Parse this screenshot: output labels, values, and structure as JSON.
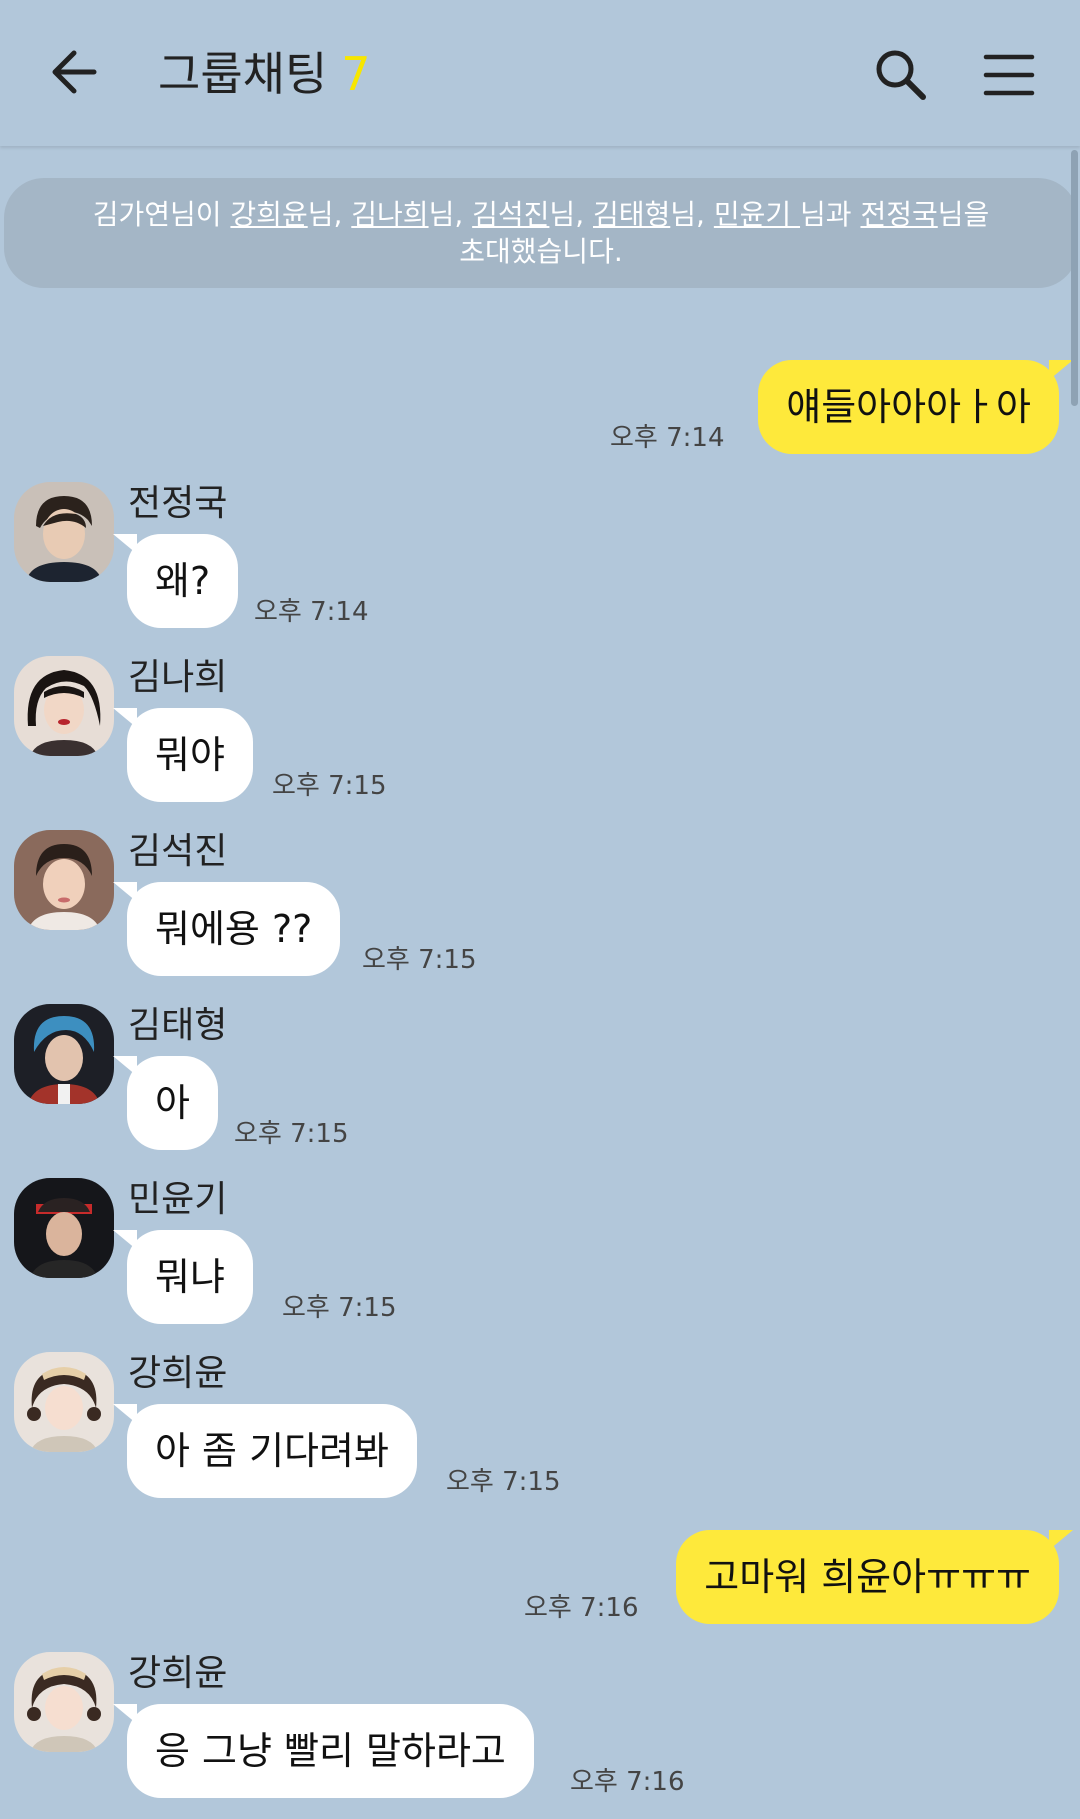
{
  "header": {
    "title": "그룹채팅",
    "member_count": "7"
  },
  "notice": {
    "inviter": "김가연",
    "invitees": [
      "강희윤",
      "김나희",
      "김석진",
      "김태형",
      "민윤기 ",
      "전정국"
    ],
    "suffix_nim": "님",
    "suffix_nim_space": " 님과 ",
    "comma": ", ",
    "suffix_i": "님이 ",
    "suffix_eul": "님을",
    "line2": "초대했습니다."
  },
  "messages": [
    {
      "sender": "",
      "text": "얘들아아아ㅏ아",
      "time": "오후 7:14",
      "mine": true
    },
    {
      "sender": "전정국",
      "text": "왜?",
      "time": "오후 7:14",
      "mine": false
    },
    {
      "sender": "김나희",
      "text": "뭐야",
      "time": "오후 7:15",
      "mine": false
    },
    {
      "sender": "김석진",
      "text": "뭐에용 ??",
      "time": "오후 7:15",
      "mine": false
    },
    {
      "sender": "김태형",
      "text": "아",
      "time": "오후 7:15",
      "mine": false
    },
    {
      "sender": "민윤기",
      "text": "뭐냐",
      "time": "오후 7:15",
      "mine": false
    },
    {
      "sender": "강희윤",
      "text": "아 좀 기다려봐",
      "time": "오후 7:15",
      "mine": false
    },
    {
      "sender": "",
      "text": "고마워 희윤아ㅠㅠㅠ",
      "time": "오후 7:16",
      "mine": true
    },
    {
      "sender": "강희윤",
      "text": "응 그냥 빨리 말하라고",
      "time": "오후 7:16",
      "mine": false
    }
  ],
  "icons": {
    "back": "arrow-left-icon",
    "search": "search-icon",
    "menu": "hamburger-menu-icon"
  },
  "colors": {
    "background": "#b2c7da",
    "my_bubble": "#fee93b",
    "their_bubble": "#ffffff",
    "member_count": "#f7e600"
  }
}
